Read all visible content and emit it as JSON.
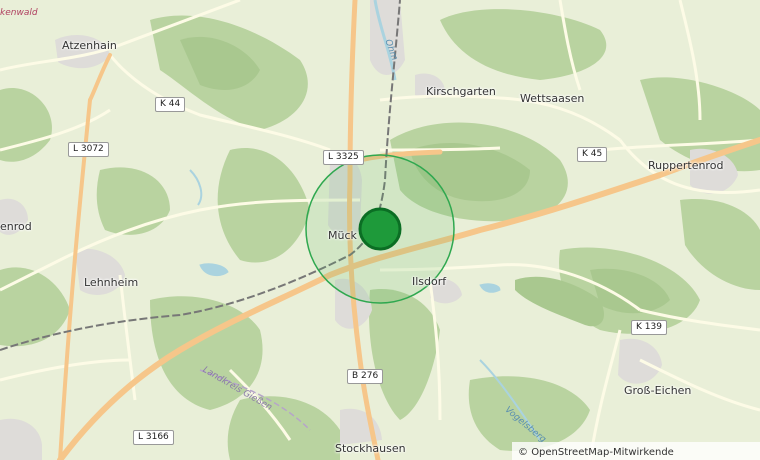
{
  "map": {
    "places": {
      "atzenhain": "Atzenhain",
      "kirschgarten": "Kirschgarten",
      "wettsaasen": "Wettsaasen",
      "ruppertenrod": "Ruppertenrod",
      "enrod": "enrod",
      "lehnheim": "Lehnheim",
      "mucke": "Mück",
      "ilsdorf": "Ilsdorf",
      "gross_eichen": "Groß-Eichen",
      "stockhausen": "Stockhausen"
    },
    "roads": {
      "k44": "K 44",
      "l3072": "L 3072",
      "l3325": "L 3325",
      "k45": "K 45",
      "k139": "K 139",
      "b276": "B 276",
      "l3166": "L 3166"
    },
    "other_labels": {
      "ohm": "Ohm",
      "landkreis": "Landkreis Gießen",
      "vogelsberg": "Vogelsberg",
      "kenwald": "kenwald"
    },
    "marker": {
      "color": "#1e9a3a",
      "radius_color": "#2fa84f"
    },
    "attribution": {
      "symbol": "©",
      "text": "OpenStreetMap-Mitwirkende"
    },
    "colors": {
      "forest": "#b9d3a0",
      "forest_dark": "#a9c88f",
      "land": "#e9efd8",
      "major_road": "#f6c68a",
      "minor_road": "#fdfbe6",
      "water": "#aad3df",
      "urban": "#dedcd9"
    }
  }
}
